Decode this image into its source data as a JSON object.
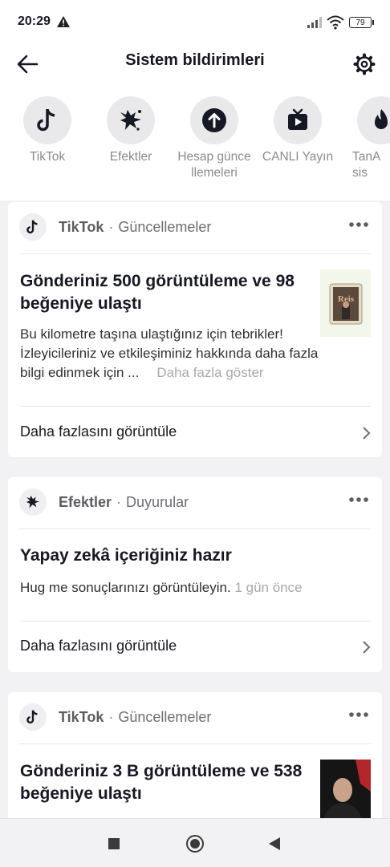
{
  "status": {
    "time": "20:29",
    "battery": "79"
  },
  "header": {
    "title": "Sistem bildirimleri"
  },
  "categories": [
    {
      "label": "TikTok",
      "icon": "tiktok-icon"
    },
    {
      "label": "Efektler",
      "icon": "effects-icon"
    },
    {
      "label": "Hesap güncellemeleri",
      "icon": "arrow-up-icon"
    },
    {
      "label": "CANLI Yayın",
      "icon": "live-tv-icon"
    },
    {
      "label": "TanAsis",
      "icon": "flame-icon"
    }
  ],
  "cards": [
    {
      "source": "TikTok",
      "category": "Güncellemeler",
      "headline": "Gönderiniz 500 görüntüleme ve 98 beğeniye ulaştı",
      "body": "Bu kilometre taşına ulaştığınız için tebrikler! İzleyicileriniz ve etkileşiminiz hakkında daha fazla bilgi edinmek için ...",
      "more": "Daha fazla göster",
      "footer": "Daha fazlasını görüntüle",
      "thumb_text": "Reis"
    },
    {
      "source": "Efektler",
      "category": "Duyurular",
      "headline": "Yapay zekâ içeriğiniz hazır",
      "body": "Hug me sonuçlarınızı görüntüleyin.",
      "time": "1 gün önce",
      "footer": "Daha fazlasını görüntüle"
    },
    {
      "source": "TikTok",
      "category": "Güncellemeler",
      "headline": "Gönderiniz 3 B görüntüleme ve 538 beğeniye ulaştı"
    }
  ]
}
